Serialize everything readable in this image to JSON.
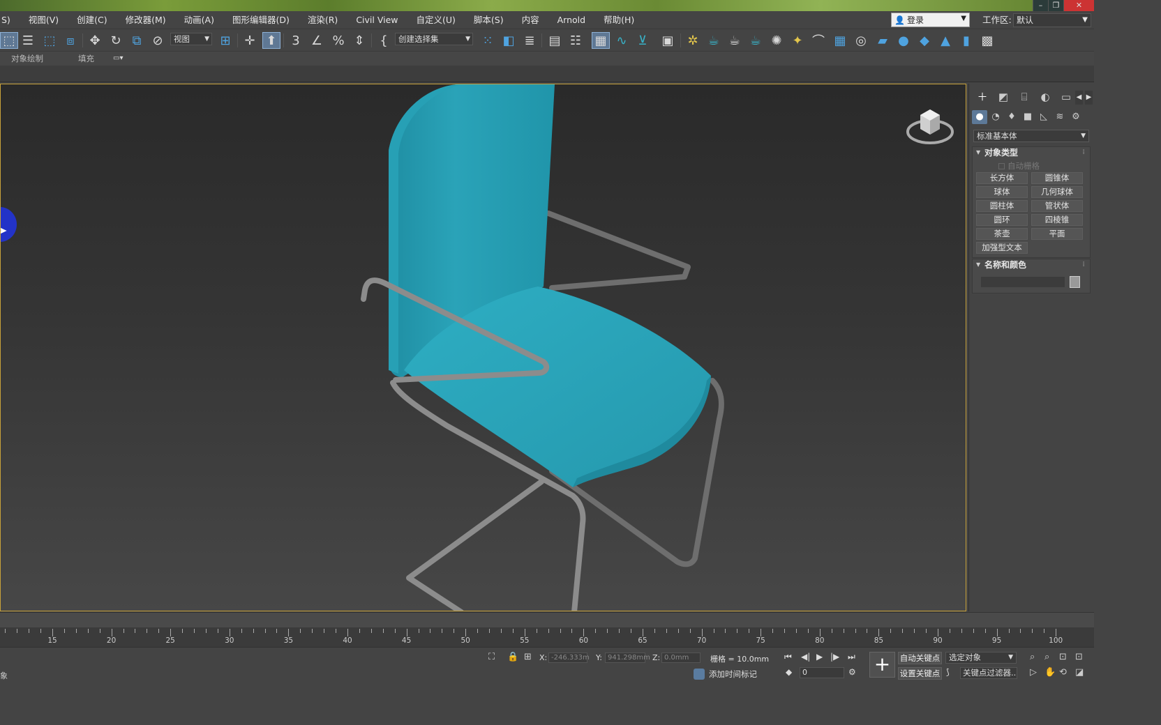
{
  "window": {
    "controls": {
      "minimize": "–",
      "restore": "❐",
      "close": "✕"
    }
  },
  "menu": {
    "items": [
      "S)",
      "视图(V)",
      "创建(C)",
      "修改器(M)",
      "动画(A)",
      "图形编辑器(D)",
      "渲染(R)",
      "Civil View",
      "自定义(U)",
      "脚本(S)",
      "内容",
      "Arnold",
      "帮助(H)"
    ]
  },
  "account": {
    "login_label": "登录",
    "user_icon": "user-icon"
  },
  "workspace": {
    "label": "工作区:",
    "value": "默认"
  },
  "toolbar": {
    "ref_coord": "视图",
    "named_sel_set": "创建选择集"
  },
  "ribbon": {
    "tabs": [
      "对象绘制",
      "填充"
    ]
  },
  "command_panel": {
    "category": "标准基本体",
    "object_type": {
      "title": "对象类型",
      "auto_grid": "自动栅格",
      "buttons": [
        "长方体",
        "圆锥体",
        "球体",
        "几何球体",
        "圆柱体",
        "管状体",
        "圆环",
        "四棱锥",
        "茶壶",
        "平面",
        "加强型文本"
      ]
    },
    "name_color": {
      "title": "名称和颜色",
      "name_value": "",
      "color": "#9a9a9a"
    }
  },
  "timeline": {
    "tick_labels": [
      "15",
      "20",
      "25",
      "30",
      "35",
      "40",
      "45",
      "50",
      "55",
      "60",
      "65",
      "70",
      "75",
      "80",
      "85",
      "90",
      "95",
      "100"
    ]
  },
  "status": {
    "left_text": "象",
    "x_label": "X:",
    "x_value": "-246.333m",
    "y_label": "Y:",
    "y_value": "941.298mm",
    "z_label": "Z:",
    "z_value": "0.0mm",
    "grid": "栅格 = 10.0mm",
    "add_time_tag": "添加时间标记",
    "frame": "0",
    "auto_key": "自动关键点",
    "set_key": "设置关键点",
    "selection_set": "选定对象",
    "key_filters": "关键点过滤器..."
  },
  "colors": {
    "viewport_border": "#c8a23a",
    "chair_seat": "#2aa3b8",
    "chair_frame": "#8c8c8c",
    "active_button": "#5f7894"
  }
}
